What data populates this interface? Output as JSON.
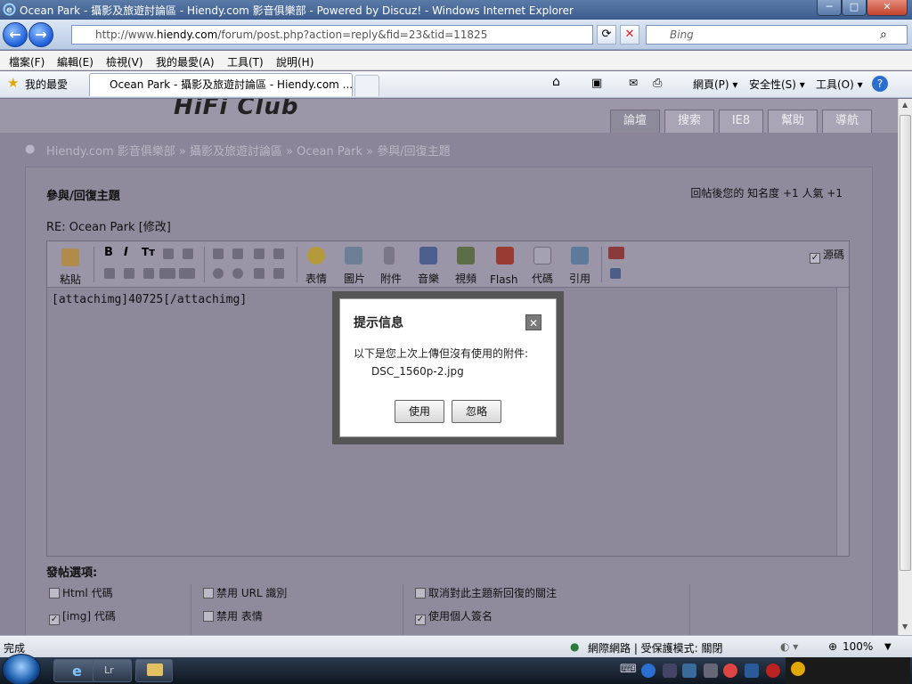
{
  "window": {
    "title": "Ocean Park - 攝影及旅遊討論區 - Hiendy.com 影音俱樂部 - Powered by Discuz! - Windows Internet Explorer",
    "min": "─",
    "max": "□",
    "close": "✕"
  },
  "nav": {
    "back": "←",
    "forward": "→",
    "url_prefix": "http://www.",
    "url_domain": "hiendy.com",
    "url_rest": "/forum/post.php?action=reply&fid=23&tid=11825",
    "search_placeholder": "Bing",
    "search_icon": "⌕"
  },
  "menu": [
    "檔案(F)",
    "編輯(E)",
    "檢視(V)",
    "我的最愛(A)",
    "工具(T)",
    "說明(H)"
  ],
  "favbar": {
    "favorites": "我的最愛",
    "tab_title": "Ocean Park - 攝影及旅遊討論區 - Hiendy.com ...",
    "commands": [
      "網頁(P) ▾",
      "安全性(S) ▾",
      "工具(O) ▾"
    ]
  },
  "site": {
    "logo": "HiFi Club",
    "tabs": [
      "論壇",
      "搜索",
      "IE8",
      "幫助",
      "導航"
    ],
    "breadcrumb": "Hiendy.com 影音俱樂部 » 攝影及旅遊討論區 » Ocean Park » 參與/回復主題",
    "page_title": "參與/回復主題",
    "reward_note": "回帖後您的 知名度 +1  人氣 +1",
    "subject": "RE: Ocean Park [修改]",
    "source_toggle": "源碼",
    "toolbar_labels": [
      "粘貼",
      "表情",
      "圖片",
      "附件",
      "音樂",
      "視頻",
      "Flash",
      "代碼",
      "引用"
    ],
    "editor_text": "[attachimg]40725[/attachimg]",
    "options_title": "發帖選項:",
    "options_col1": [
      "Html 代碼",
      "[img] 代碼"
    ],
    "options_col2": [
      "禁用 URL 識別",
      "禁用 表情"
    ],
    "options_col3": [
      "取消對此主題新回復的關注",
      "使用個人簽名"
    ]
  },
  "modal": {
    "title": "提示信息",
    "close": "✕",
    "message": "以下是您上次上傳但沒有使用的附件:",
    "file": "DSC_1560p-2.jpg",
    "use_btn": "使用",
    "ignore_btn": "忽略"
  },
  "status": {
    "text": "完成",
    "zone": "網際網路 | 受保護模式: 關閉",
    "zoom": "100%"
  },
  "colors": {
    "accent": "#1d5ed8",
    "overlay": "#8a8599"
  }
}
